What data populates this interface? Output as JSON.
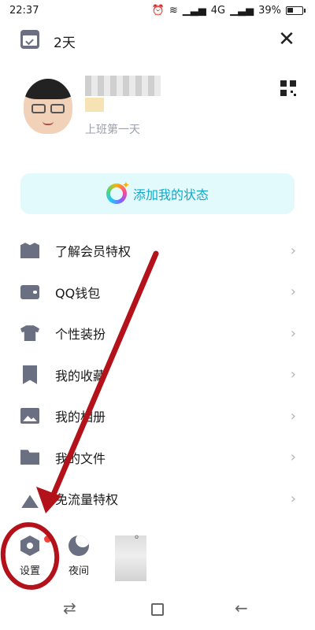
{
  "status_bar": {
    "time": "22:37",
    "network": "4G",
    "battery": "39%"
  },
  "header": {
    "days": "2天"
  },
  "profile": {
    "subtitle": "上班第一天"
  },
  "status_button": {
    "label": "添加我的状态"
  },
  "menu": [
    {
      "label": "了解会员特权",
      "icon": "vip-icon"
    },
    {
      "label": "QQ钱包",
      "icon": "wallet-icon"
    },
    {
      "label": "个性装扮",
      "icon": "shirt-icon"
    },
    {
      "label": "我的收藏",
      "icon": "bookmark-icon"
    },
    {
      "label": "我的相册",
      "icon": "photo-icon"
    },
    {
      "label": "我的文件",
      "icon": "folder-icon"
    },
    {
      "label": "免流量特权",
      "icon": "tower-icon"
    }
  ],
  "bottom": {
    "settings_label": "设置",
    "night_label": "夜间",
    "weather_degree": "°"
  },
  "colors": {
    "icon_gray": "#6b6f82",
    "accent_cyan": "#14a8c8",
    "status_bg": "#e3fafd",
    "annotation_red": "#b3121b",
    "badge_red": "#f44336"
  }
}
